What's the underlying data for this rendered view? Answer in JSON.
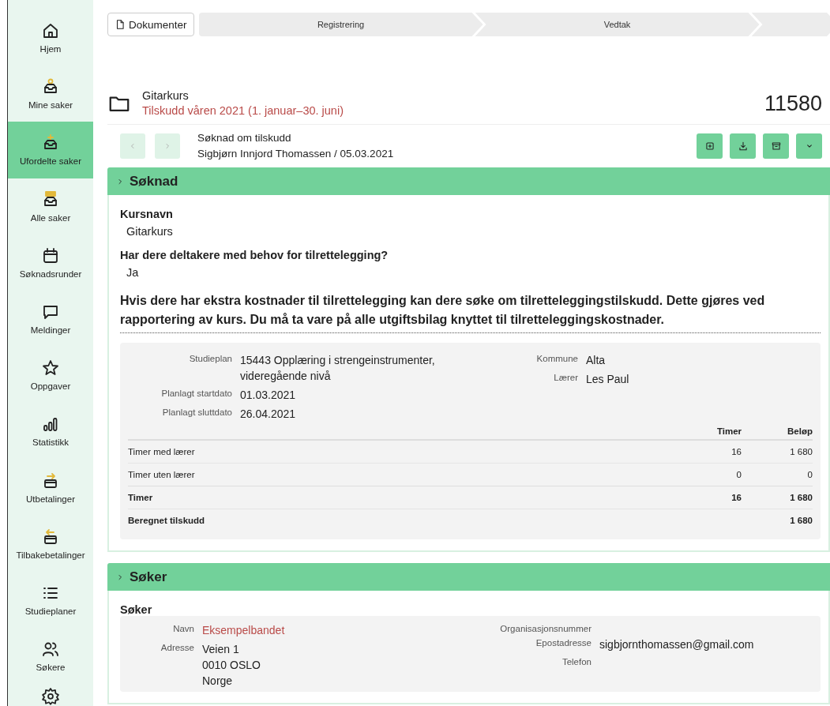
{
  "sidebar": {
    "items": [
      {
        "label": "Hjem",
        "selected": false
      },
      {
        "label": "Mine saker",
        "selected": false
      },
      {
        "label": "Ufordelte saker",
        "selected": true
      },
      {
        "label": "Alle saker",
        "selected": false
      },
      {
        "label": "Søknadsrunder",
        "selected": false
      },
      {
        "label": "Meldinger",
        "selected": false
      },
      {
        "label": "Oppgaver",
        "selected": false
      },
      {
        "label": "Statistikk",
        "selected": false
      },
      {
        "label": "Utbetalinger",
        "selected": false
      },
      {
        "label": "Tilbakebetalinger",
        "selected": false
      },
      {
        "label": "Studieplaner",
        "selected": false
      },
      {
        "label": "Søkere",
        "selected": false
      }
    ]
  },
  "toolbar": {
    "documents_button": "Dokumenter",
    "steps": [
      {
        "label": "Registrering"
      },
      {
        "label": "Vedtak"
      }
    ]
  },
  "case": {
    "title": "Gitarkurs",
    "subtitle": "Tilskudd våren 2021 (1. januar–30. juni)",
    "number": "11580"
  },
  "document": {
    "title": "Søknad om tilskudd",
    "meta": "Sigbjørn Innjord Thomassen / 05.03.2021",
    "prev": {
      "disabled": true
    },
    "next": {
      "disabled": true
    }
  },
  "application": {
    "title": "Søknad",
    "questions": [
      {
        "label": "Kursnavn",
        "value": "Gitarkurs"
      },
      {
        "label": "Har dere deltakere med behov for tilrettelegging?",
        "value": "Ja"
      }
    ],
    "notice": "Hvis dere har ekstra kostnader til tilrettelegging kan dere søke om tilretteleggingstilskudd. Dette gjøres ved rapportering av kurs. Du må ta vare på alle utgiftsbilag knyttet til tilretteleggingskostnader.",
    "details_left": [
      {
        "label": "Studieplan",
        "lines": [
          "15443 Opplæring i strengeinstrumenter,",
          "videregående nivå"
        ]
      },
      {
        "label": "Planlagt startdato",
        "lines": [
          "01.03.2021"
        ]
      },
      {
        "label": "Planlagt sluttdato",
        "lines": [
          "26.04.2021"
        ]
      }
    ],
    "details_right": [
      {
        "label": "Kommune",
        "lines": [
          "Alta"
        ]
      },
      {
        "label": "Lærer",
        "lines": [
          "Les Paul"
        ]
      }
    ],
    "table": {
      "columns": [
        {
          "label": "Timer"
        },
        {
          "label": "Beløp"
        }
      ],
      "rows": [
        {
          "label": "Timer med lærer",
          "hours": "16",
          "amount": "1 680",
          "bold": false
        },
        {
          "label": "Timer uten lærer",
          "hours": "0",
          "amount": "0",
          "bold": false
        },
        {
          "label": "Timer",
          "hours": "16",
          "amount": "1 680",
          "bold": true
        },
        {
          "label": "Beregnet tilskudd",
          "amount": "1 680",
          "bold": true
        }
      ]
    }
  },
  "applicant": {
    "title": "Søker",
    "subtitle": "Søker",
    "details_left": [
      {
        "label": "Navn",
        "lines": [
          "Eksempelbandet"
        ],
        "link": true
      },
      {
        "label": "Adresse",
        "lines": [
          "Veien 1",
          "0010 OSLO",
          "Norge"
        ],
        "link": false
      }
    ],
    "details_right": [
      {
        "label": "Organisasjonsnummer"
      },
      {
        "label": "Epostadresse",
        "lines": [
          "sigbjornthomassen@gmail.com"
        ],
        "link": false
      },
      {
        "label": "Telefon"
      }
    ]
  }
}
